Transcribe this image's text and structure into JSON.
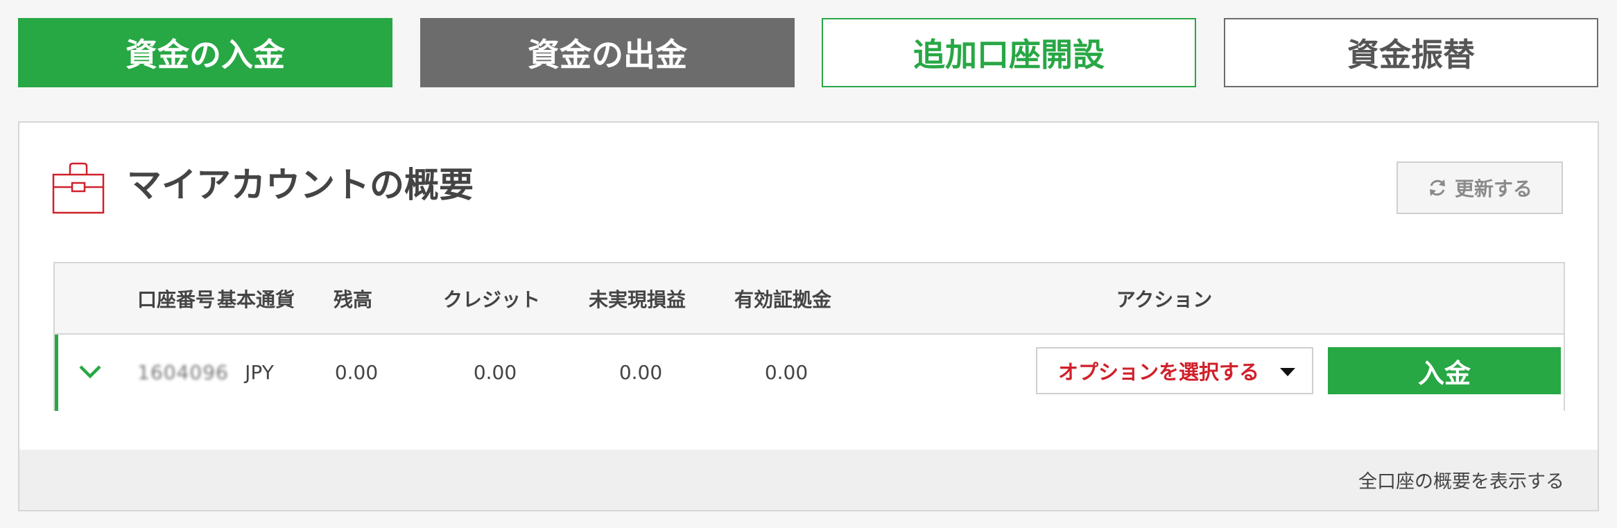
{
  "top_buttons": {
    "deposit": "資金の入金",
    "withdraw": "資金の出金",
    "open_account": "追加口座開設",
    "transfer": "資金振替"
  },
  "colors": {
    "green": "#28a745",
    "gray": "#6c6c6c",
    "red": "#d0202a"
  },
  "panel": {
    "title": "マイアカウントの概要",
    "icon": "briefcase-icon",
    "refresh_label": "更新する"
  },
  "table": {
    "headers": [
      "口座番号",
      "基本通貨",
      "残高",
      "クレジット",
      "未実現損益",
      "有効証拠金",
      "アクション"
    ],
    "row": {
      "account": "1604096",
      "currency": "JPY",
      "balance": "0.00",
      "credit": "0.00",
      "unrealized": "0.00",
      "equity": "0.00",
      "select_placeholder": "オプションを選択する",
      "deposit_label": "入金"
    }
  },
  "footer": {
    "link": "全口座の概要を表示する"
  }
}
